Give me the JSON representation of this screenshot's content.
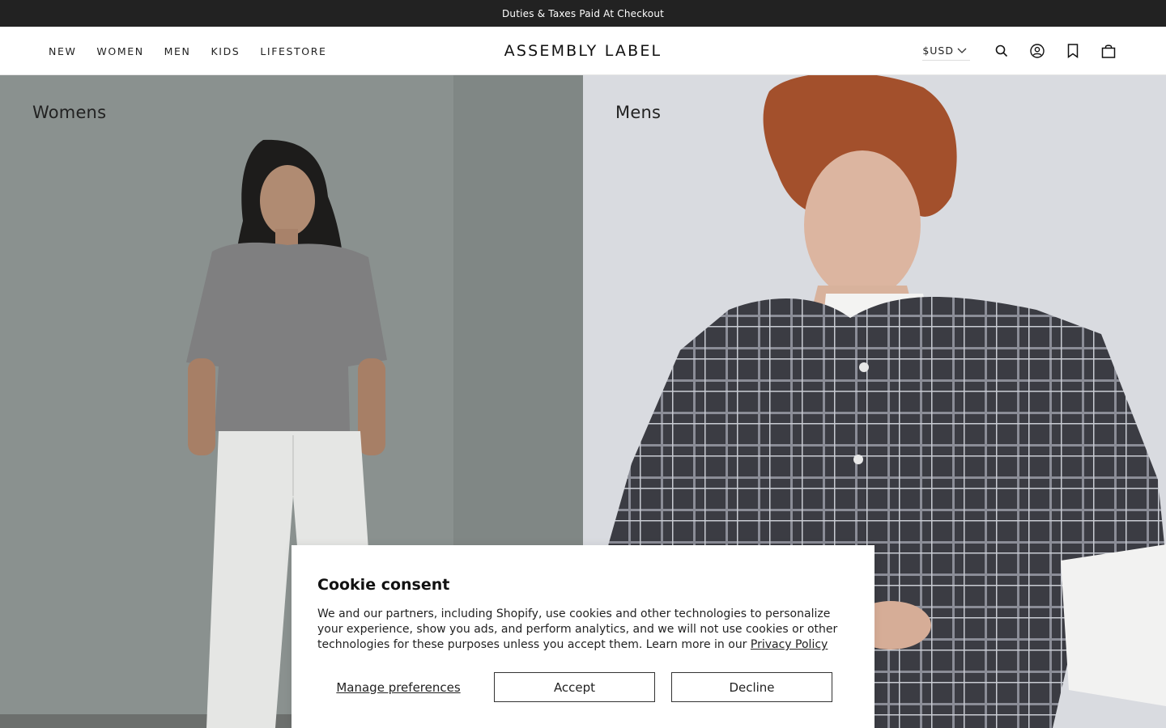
{
  "announcement": "Duties & Taxes Paid At Checkout",
  "nav": [
    "NEW",
    "WOMEN",
    "MEN",
    "KIDS",
    "LIFESTORE"
  ],
  "logo": "ASSEMBLY LABEL",
  "currency": "$USD",
  "icons": [
    "search-icon",
    "account-icon",
    "wishlist-icon",
    "bag-icon"
  ],
  "hero": {
    "left_title": "Womens",
    "right_title": "Mens"
  },
  "consent": {
    "title": "Cookie consent",
    "body": "We and our partners, including Shopify, use cookies and other technologies to personalize your experience, show you ads, and perform analytics, and we will not use cookies or other technologies for these purposes unless you accept them. Learn more in our",
    "link": "Privacy Policy",
    "manage": "Manage preferences",
    "accept": "Accept",
    "decline": "Decline"
  }
}
